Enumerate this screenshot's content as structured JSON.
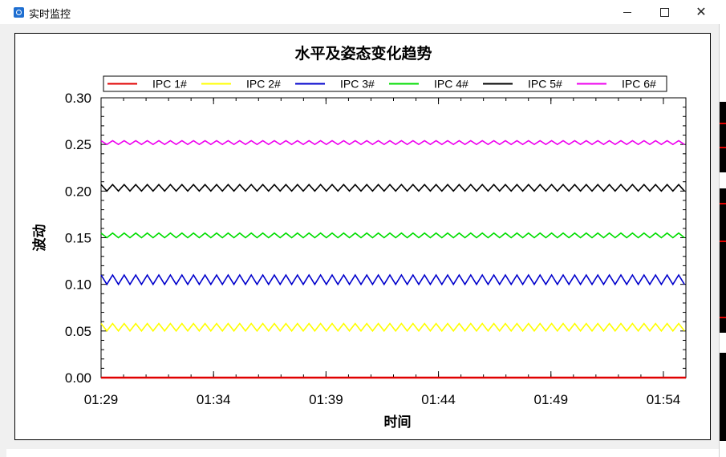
{
  "window": {
    "title": "实时监控",
    "icon": "monitor-app-icon",
    "controls": [
      "minimize-icon",
      "maximize-icon",
      "close-icon"
    ]
  },
  "chart_data": {
    "type": "line",
    "title": "水平及姿态变化趋势",
    "xlabel": "时间",
    "ylabel": "波动",
    "ylim": [
      0,
      0.3
    ],
    "yticks": [
      "0.00",
      "0.05",
      "0.10",
      "0.15",
      "0.20",
      "0.25",
      "0.30"
    ],
    "xticks": [
      "01:29",
      "01:34",
      "01:39",
      "01:44",
      "01:49",
      "01:54"
    ],
    "xrange": [
      "01:29",
      "01:55"
    ],
    "grid": false,
    "legend_placement": "top",
    "series": [
      {
        "name": "IPC 1#",
        "color": "#e00000",
        "values": [
          0.0,
          0.0
        ],
        "pattern": "flat"
      },
      {
        "name": "IPC 2#",
        "color": "#ffff00",
        "values": [
          0.05,
          0.058
        ],
        "pattern": "zigzag"
      },
      {
        "name": "IPC 3#",
        "color": "#0000cc",
        "values": [
          0.1,
          0.11
        ],
        "pattern": "zigzag"
      },
      {
        "name": "IPC 4#",
        "color": "#00dd00",
        "values": [
          0.15,
          0.155
        ],
        "pattern": "zigzag"
      },
      {
        "name": "IPC 5#",
        "color": "#000000",
        "values": [
          0.2,
          0.207
        ],
        "pattern": "zigzag"
      },
      {
        "name": "IPC 6#",
        "color": "#ee00ee",
        "values": [
          0.25,
          0.254
        ],
        "pattern": "zigzag"
      }
    ]
  }
}
